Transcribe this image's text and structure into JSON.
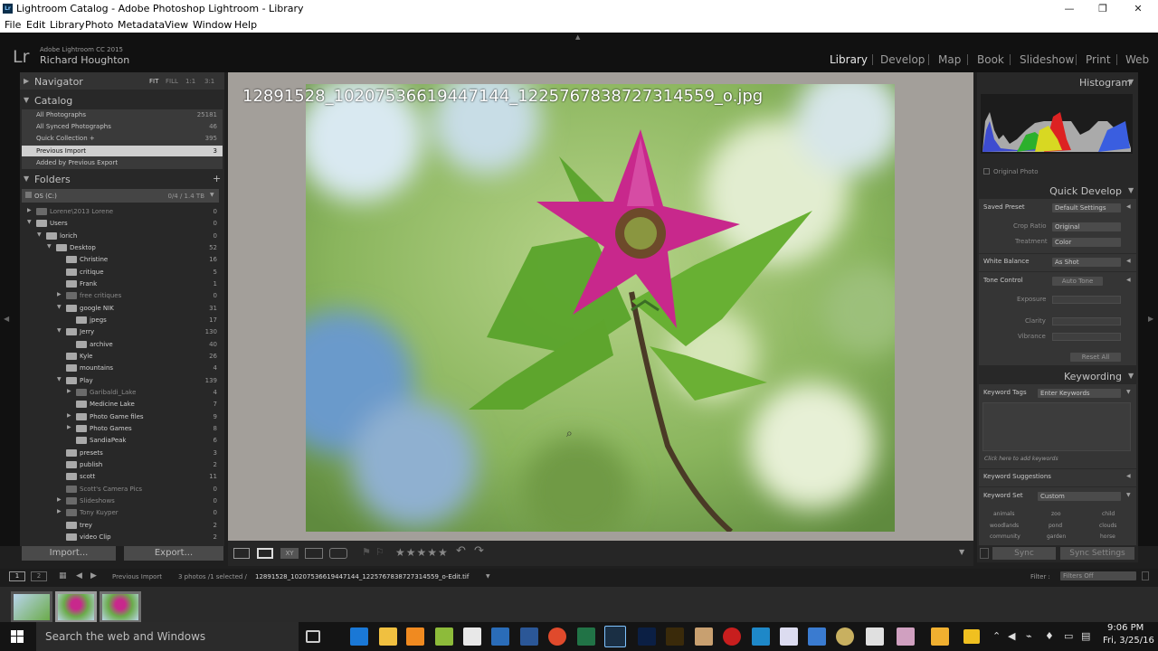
{
  "window": {
    "title": "Lightroom Catalog - Adobe Photoshop Lightroom - Library"
  },
  "menu": [
    "File",
    "Edit",
    "Library",
    "Photo",
    "Metadata",
    "View",
    "Window",
    "Help"
  ],
  "identity": {
    "logo": "Lr",
    "version": "Adobe Lightroom CC 2015",
    "user": "Richard Houghton"
  },
  "modules": [
    "Library",
    "Develop",
    "Map",
    "Book",
    "Slideshow",
    "Print",
    "Web"
  ],
  "navigator": {
    "title": "Navigator",
    "zoom": [
      "FIT",
      "FILL",
      "1:1",
      "3:1"
    ]
  },
  "catalog": {
    "title": "Catalog",
    "items": [
      {
        "label": "All Photographs",
        "count": "25181"
      },
      {
        "label": "All Synced Photographs",
        "count": "46"
      },
      {
        "label": "Quick Collection +",
        "count": "395"
      },
      {
        "label": "Previous Import",
        "count": "3"
      },
      {
        "label": "Added by Previous Export",
        "count": ""
      }
    ]
  },
  "folders": {
    "title": "Folders",
    "add": "+",
    "volume": {
      "label": "OS (C:)",
      "size": "0/4 / 1.4 TB"
    },
    "items": [
      {
        "label": "Lorene\\2013 Lorene",
        "count": "0"
      },
      {
        "label": "Users",
        "count": "0"
      },
      {
        "label": "lorich",
        "count": "0"
      },
      {
        "label": "Desktop",
        "count": "52"
      },
      {
        "label": "Christine",
        "count": "16"
      },
      {
        "label": "critique",
        "count": "5"
      },
      {
        "label": "Frank",
        "count": "1"
      },
      {
        "label": "free critiques",
        "count": "0"
      },
      {
        "label": "google NIK",
        "count": "31"
      },
      {
        "label": "jpegs",
        "count": "17"
      },
      {
        "label": "Jerry",
        "count": "130"
      },
      {
        "label": "archive",
        "count": "40"
      },
      {
        "label": "Kyle",
        "count": "26"
      },
      {
        "label": "mountains",
        "count": "4"
      },
      {
        "label": "Play",
        "count": "139"
      },
      {
        "label": "Garibaldi_Lake",
        "count": "4"
      },
      {
        "label": "Medicine Lake",
        "count": "7"
      },
      {
        "label": "Photo Game files",
        "count": "9"
      },
      {
        "label": "Photo Games",
        "count": "8"
      },
      {
        "label": "SandiaPeak",
        "count": "6"
      },
      {
        "label": "presets",
        "count": "3"
      },
      {
        "label": "publish",
        "count": "2"
      },
      {
        "label": "scott",
        "count": "11"
      },
      {
        "label": "Scott's Camera Pics",
        "count": "0"
      },
      {
        "label": "Slideshows",
        "count": "0"
      },
      {
        "label": "Tony Kuyper",
        "count": "0"
      },
      {
        "label": "trey",
        "count": "2"
      },
      {
        "label": "video Clip",
        "count": "2"
      }
    ]
  },
  "left_buttons": {
    "import": "Import...",
    "export": "Export..."
  },
  "photo": {
    "filename": "12891528_10207536619447144_1225767838727314559_o.jpg"
  },
  "histogram": {
    "title": "Histogram",
    "original": "Original Photo"
  },
  "quick_develop": {
    "title": "Quick Develop",
    "saved_preset": {
      "label": "Saved Preset",
      "value": "Default Settings"
    },
    "crop_ratio": {
      "label": "Crop Ratio",
      "value": "Original"
    },
    "treatment": {
      "label": "Treatment",
      "value": "Color"
    },
    "white_balance": {
      "label": "White Balance",
      "value": "As Shot"
    },
    "tone_control": {
      "label": "Tone Control",
      "value": "Auto Tone"
    },
    "exposure": "Exposure",
    "clarity": "Clarity",
    "vibrance": "Vibrance",
    "reset": "Reset All"
  },
  "keywording": {
    "title": "Keywording",
    "tags_label": "Keyword Tags",
    "tags_value": "Enter Keywords",
    "hint": "Click here to add keywords",
    "suggestions": "Keyword Suggestions",
    "set_label": "Keyword Set",
    "set_value": "Custom",
    "words": [
      "animals",
      "zoo",
      "child",
      "woodlands",
      "pond",
      "clouds",
      "community",
      "garden",
      "horse"
    ]
  },
  "sync": {
    "sync": "Sync",
    "settings": "Sync Settings"
  },
  "toolbar": {
    "stars": "★★★★★"
  },
  "filmstrip": {
    "pages": [
      "1",
      "2"
    ],
    "source": "Previous Import",
    "info": "3 photos /1 selected /",
    "file": "12891528_10207536619447144_1225767838727314559_o-Edit.tif",
    "filter_label": "Filter :",
    "filter_value": "Filters Off"
  },
  "taskbar": {
    "search": "Search the web and Windows",
    "time": "9:06 PM",
    "date": "Fri, 3/25/16"
  }
}
